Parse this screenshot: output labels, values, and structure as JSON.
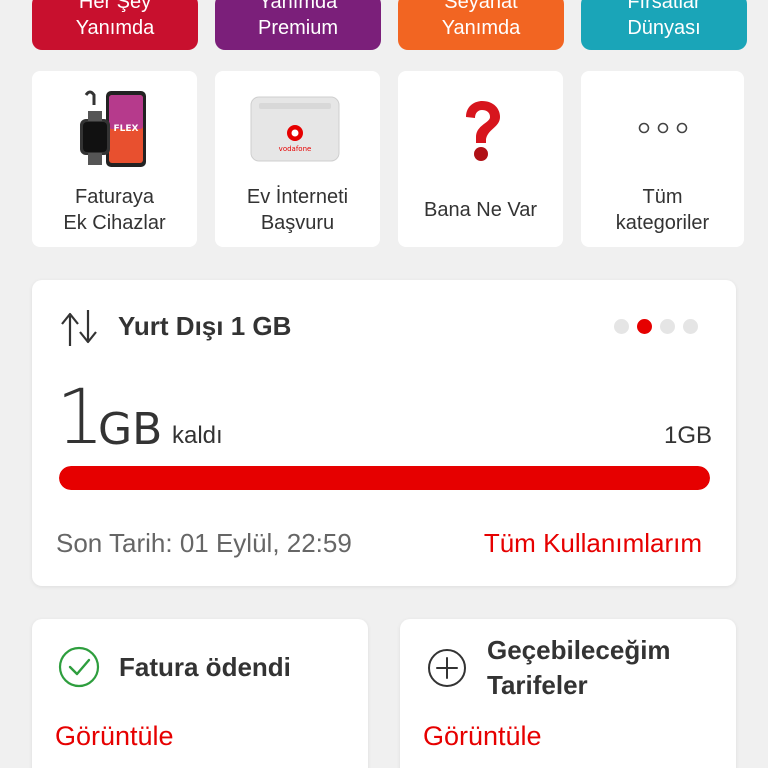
{
  "top_tiles": [
    {
      "line1": "Her Şey",
      "line2": "Yanımda",
      "color": "#c8102e"
    },
    {
      "line1": "Yanımda",
      "line2": "Premium",
      "color": "#7b1f7a"
    },
    {
      "line1": "Seyahat",
      "line2": "Yanımda",
      "color": "#f26522"
    },
    {
      "line1": "Fırsatlar",
      "line2": "Dünyası",
      "color": "#1aa5b8"
    }
  ],
  "categories": [
    {
      "line1": "Faturaya",
      "line2": "Ek Cihazlar",
      "icon": "devices-icon"
    },
    {
      "line1": "Ev İnterneti",
      "line2": "Başvuru",
      "icon": "modem-icon"
    },
    {
      "line1": "Bana Ne Var",
      "line2": "",
      "icon": "question-mark-icon"
    },
    {
      "line1": "Tüm",
      "line2": "kategoriler",
      "icon": "more-dots-icon"
    }
  ],
  "usage_card": {
    "title": "Yurt Dışı 1 GB",
    "remaining_value": "1",
    "remaining_unit": "GB",
    "remaining_label": "kaldı",
    "total": "1GB",
    "fill_fraction": 1.0,
    "deadline": "Son Tarih: 01 Eylül, 22:59",
    "all_usage_link": "Tüm Kullanımlarım",
    "active_dot": 1,
    "dot_count": 4
  },
  "bill_card": {
    "title": "Fatura ödendi",
    "link": "Görüntüle"
  },
  "tariffs_card": {
    "title_line1": "Geçebileceğim",
    "title_line2": "Tarifeler",
    "link": "Görüntüle"
  },
  "colors": {
    "accent": "#e60000"
  }
}
